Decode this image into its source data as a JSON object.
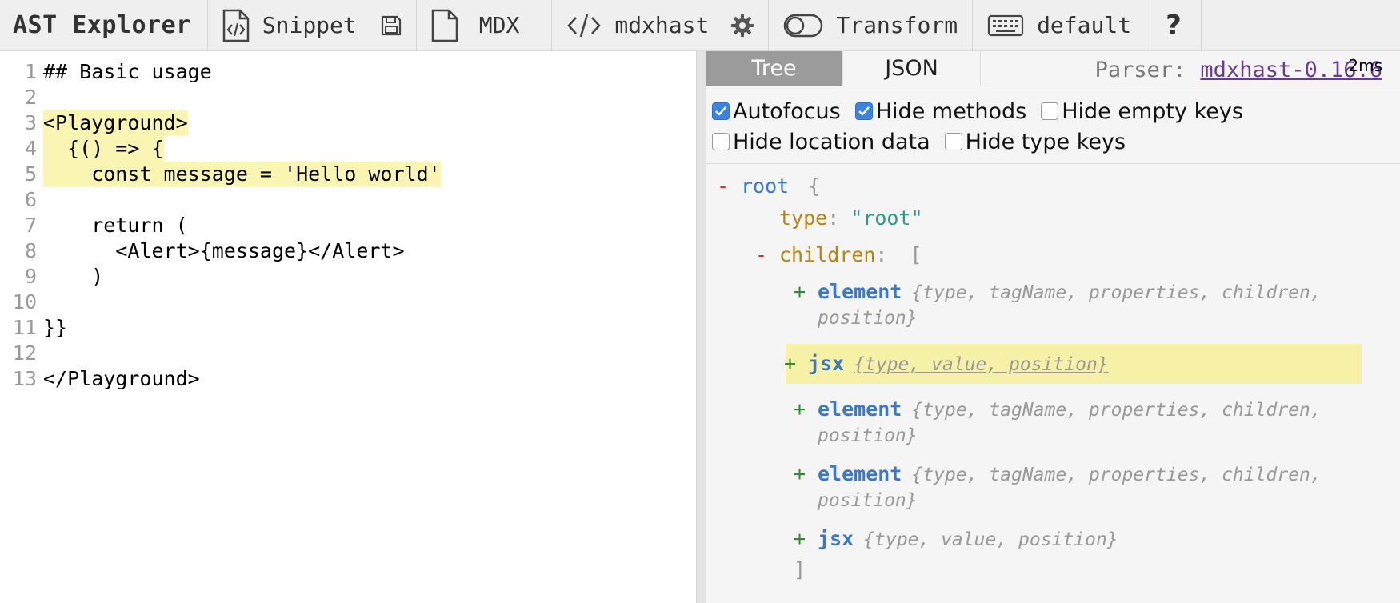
{
  "toolbar": {
    "title": "AST Explorer",
    "snippet_label": "Snippet",
    "language_label": "MDX",
    "parser_label": "mdxhast",
    "transform_label": "Transform",
    "keymap_label": "default",
    "help_label": "?"
  },
  "editor": {
    "lines": [
      {
        "num": "1",
        "text": "## Basic usage"
      },
      {
        "num": "2",
        "text": ""
      },
      {
        "num": "3",
        "text": "<Playground>"
      },
      {
        "num": "4",
        "text": "  {() => {"
      },
      {
        "num": "5",
        "text": "    const message = 'Hello world'"
      },
      {
        "num": "6",
        "text": ""
      },
      {
        "num": "7",
        "text": "    return ("
      },
      {
        "num": "8",
        "text": "      <Alert>{message}</Alert>"
      },
      {
        "num": "9",
        "text": "    )"
      },
      {
        "num": "10",
        "text": ""
      },
      {
        "num": "11",
        "text": "}}"
      },
      {
        "num": "12",
        "text": ""
      },
      {
        "num": "13",
        "text": "</Playground>"
      }
    ]
  },
  "output": {
    "tabs": [
      "Tree",
      "JSON"
    ],
    "active_tab": "Tree",
    "parser_prefix": "Parser:",
    "parser_name": "mdxhast-0.16.6",
    "parse_time": "2ms",
    "options": {
      "autofocus": {
        "label": "Autofocus",
        "checked": true
      },
      "hide_methods": {
        "label": "Hide methods",
        "checked": true
      },
      "hide_empty_keys": {
        "label": "Hide empty keys",
        "checked": false
      },
      "hide_location": {
        "label": "Hide location data",
        "checked": false
      },
      "hide_type_keys": {
        "label": "Hide type keys",
        "checked": false
      }
    },
    "tree": {
      "root_toggle": "-",
      "root_key": "root",
      "root_open": "{",
      "type_key": "type",
      "colon": ":",
      "type_value": "\"root\"",
      "children_toggle": "-",
      "children_key": "children",
      "children_open": "[",
      "children_close": "]",
      "nodes": [
        {
          "toggle": "+",
          "type": "element",
          "summary_l1": "{type, tagName, properties, children,",
          "summary_l2": "position}"
        },
        {
          "toggle": "+",
          "type": "jsx",
          "summary_l1": "{type, value, position}"
        },
        {
          "toggle": "+",
          "type": "element",
          "summary_l1": "{type, tagName, properties, children,",
          "summary_l2": "position}"
        },
        {
          "toggle": "+",
          "type": "element",
          "summary_l1": "{type, tagName, properties, children,",
          "summary_l2": "position}"
        },
        {
          "toggle": "+",
          "type": "jsx",
          "summary_l1": "{type, value, position}"
        }
      ]
    }
  },
  "colors": {
    "highlight": "#fbf5b4",
    "checkbox_on": "#3b84e0",
    "link": "#6b3a99",
    "minus_toggle": "#d9362b",
    "plus_toggle": "#2e8b2e",
    "node_type": "#3b78c8",
    "prop_key": "#b8860b",
    "string": "#2e9a8d"
  },
  "icons": {
    "snippet": "code-file-icon",
    "save": "save-icon",
    "file": "file-icon",
    "code": "code-brackets-icon",
    "settings": "gear-icon",
    "toggle": "toggle-icon",
    "keyboard": "keyboard-icon"
  }
}
